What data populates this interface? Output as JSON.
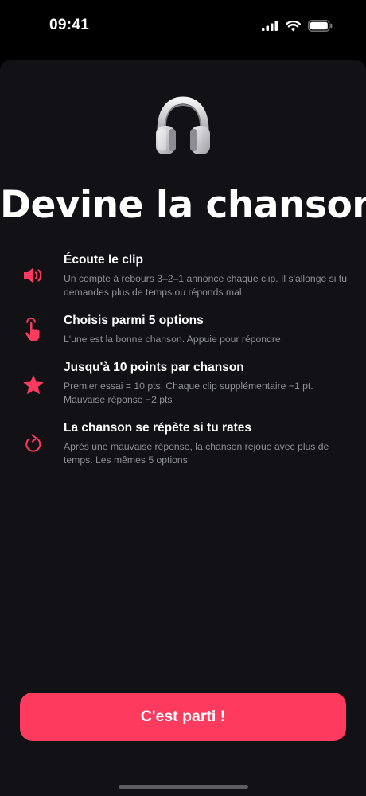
{
  "status_bar": {
    "time": "09:41",
    "icons": [
      "cellular-signal-icon",
      "wifi-icon",
      "battery-icon"
    ]
  },
  "hero": {
    "icon": "headphones-icon",
    "title": "Devine la chanson"
  },
  "rules": [
    {
      "icon": "speaker-icon",
      "title": "Écoute le clip",
      "description": "Un compte à rebours 3–2–1 annonce chaque clip. Il s'allonge si tu demandes plus de temps ou réponds mal"
    },
    {
      "icon": "tap-hand-icon",
      "title": "Choisis parmi 5 options",
      "description": "L'une est la bonne chanson. Appuie pour répondre"
    },
    {
      "icon": "star-icon",
      "title": "Jusqu'à 10 points par chanson",
      "description": "Premier essai = 10 pts. Chaque clip supplémentaire −1 pt. Mauvaise réponse −2 pts"
    },
    {
      "icon": "replay-icon",
      "title": "La chanson se répète si tu rates",
      "description": "Après une mauvaise réponse, la chanson rejoue avec plus de temps. Les mêmes 5 options"
    }
  ],
  "cta": {
    "label": "C'est parti !"
  },
  "colors": {
    "accent": "#fe3a5e",
    "background": "#111116",
    "muted_text": "#8e8e96"
  }
}
